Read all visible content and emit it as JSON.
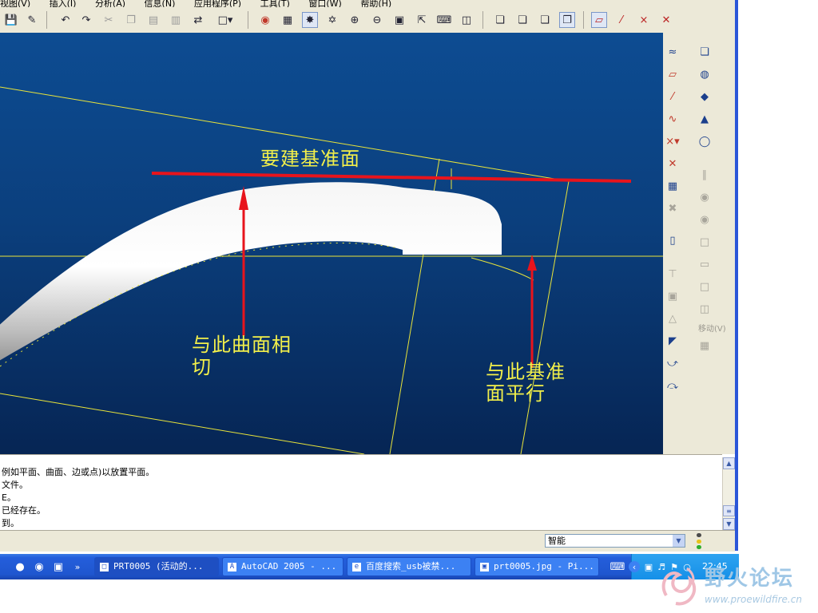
{
  "menubar": {
    "items": [
      "视图(V)",
      "插入(I)",
      "分析(A)",
      "信息(N)",
      "应用程序(P)",
      "工具(T)",
      "窗口(W)",
      "帮助(H)"
    ]
  },
  "toolbar": {
    "icons": [
      "save-icon",
      "edit-icon",
      "undo-icon",
      "redo-icon",
      "cut-icon",
      "copy-icon",
      "paste-icon",
      "paste-special-icon",
      "regenerate-icon",
      "select-box-icon",
      "appearance-icon",
      "model-display-icon",
      "datum-display-icon",
      "spin-center-icon",
      "zoom-in-icon",
      "zoom-out-icon",
      "refit-icon",
      "reorient-icon",
      "named-view-icon",
      "saved-views-icon",
      "wireframe-icon",
      "hidden-line-icon",
      "no-hidden-icon",
      "shading-icon",
      "datum-plane-display-icon",
      "datum-axis-display-icon",
      "datum-point-display-icon",
      "csys-display-icon"
    ]
  },
  "viewport": {
    "annotations": {
      "target_plane": "要建基准面",
      "tangent_line1": "与此曲面相",
      "tangent_line2": "切",
      "parallel_line1": "与此基准",
      "parallel_line2": "面平行"
    },
    "colors": {
      "annotation_text": "#f2ef4a",
      "red_marker": "#e8141c",
      "datum_yellow": "#e9e43a"
    }
  },
  "right_toolbar": {
    "move_label": "移动(V)"
  },
  "messages": [
    "例如平面、曲面、边或点)以放置平面。",
    "文件。",
    "E。",
    "已经存在。",
    "到。"
  ],
  "status": {
    "filter_value": "智能"
  },
  "taskbar": {
    "tasks": [
      "PRT0005 (活动的...",
      "AutoCAD 2005 - ...",
      "百度搜索_usb被禁...",
      "prt0005.jpg - Pi..."
    ],
    "clock": "22:45"
  },
  "watermark": {
    "title": "野火论坛",
    "url": "www.proewildfire.cn"
  }
}
